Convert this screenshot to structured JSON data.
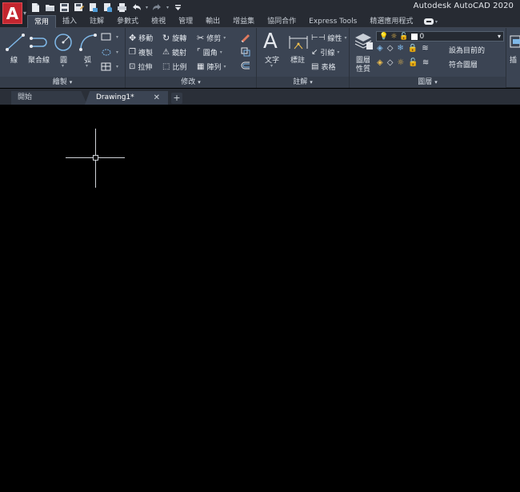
{
  "app": {
    "title": "Autodesk AutoCAD 2020",
    "logo_letter": "A"
  },
  "ribbon_tabs": [
    "常用",
    "插入",
    "註解",
    "參數式",
    "檢視",
    "管理",
    "輸出",
    "增益集",
    "協同合作",
    "Express Tools",
    "精選應用程式"
  ],
  "draw_panel": {
    "title": "繪製",
    "line": "線",
    "polyline": "聚合線",
    "circle": "圓",
    "arc": "弧"
  },
  "modify_panel": {
    "title": "修改",
    "move": "移動",
    "rotate": "旋轉",
    "trim": "修剪",
    "copy": "複製",
    "mirror": "鏡射",
    "fillet": "圓角",
    "stretch": "拉伸",
    "scale": "比例",
    "array": "陣列"
  },
  "annotation_panel": {
    "title": "註解",
    "text": "文字",
    "dimension": "標註",
    "linear": "線性",
    "leader": "引線",
    "table": "表格"
  },
  "layers_panel": {
    "title": "圖層",
    "layer_properties_line1": "圖層",
    "layer_properties_line2": "性質",
    "current_layer": "0",
    "set_current": "設為目前的",
    "match_layer": "符合圖層"
  },
  "insert_panel": {
    "label": "插"
  },
  "doc_tabs": {
    "start": "開始",
    "drawing": "Drawing1*",
    "close": "✕",
    "add": "+"
  },
  "colors": {
    "accent": "#c3262f",
    "ribbon": "#3b4453",
    "canvas": "#000000"
  }
}
